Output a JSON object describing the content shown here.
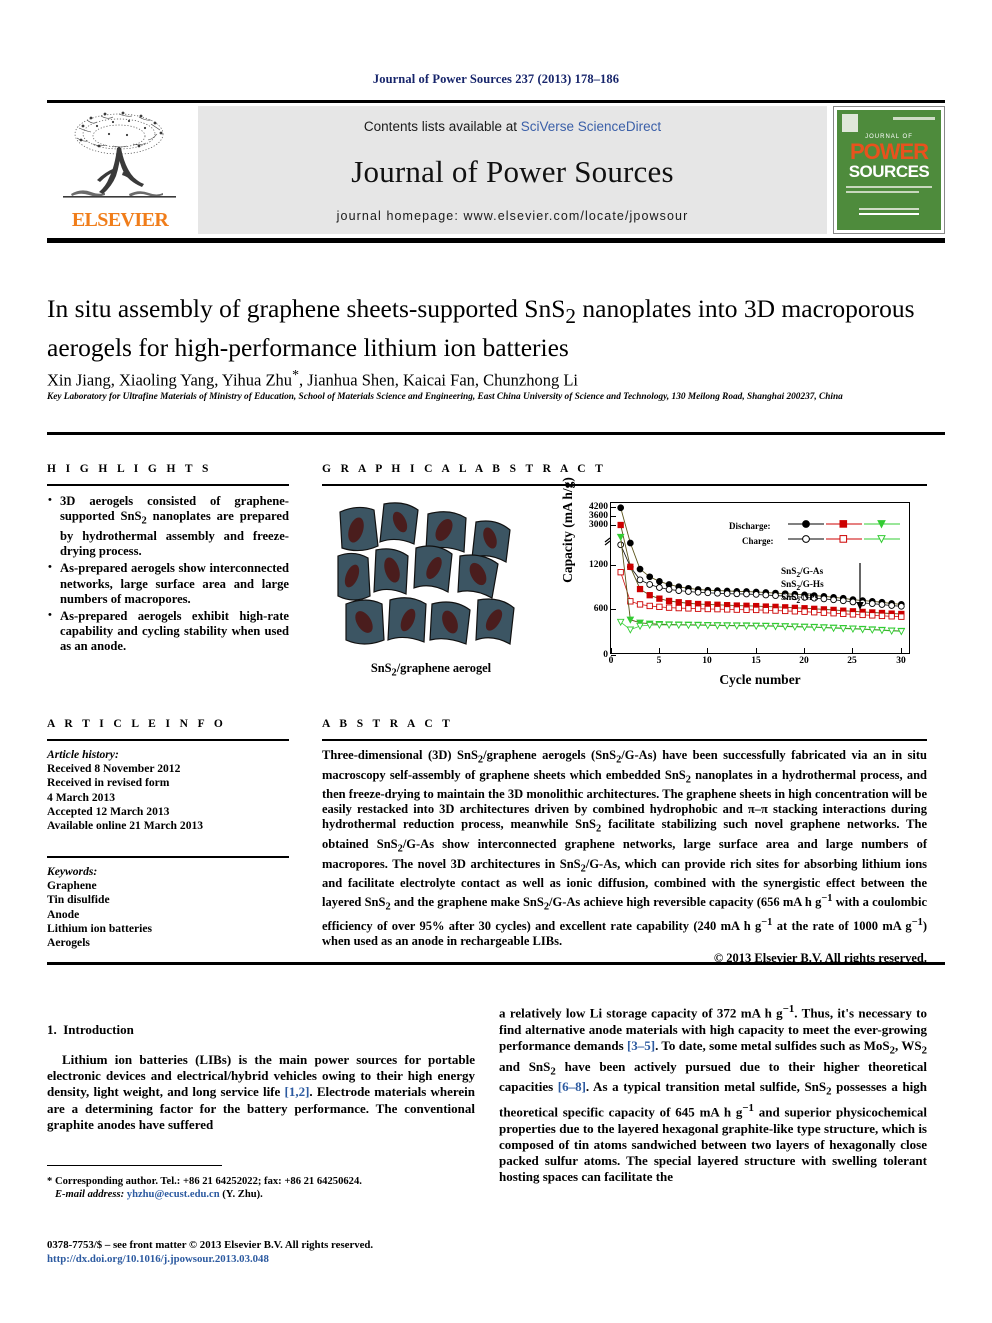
{
  "running_head": "Journal of Power Sources 237 (2013) 178–186",
  "banner": {
    "contents_prefix": "Contents lists available at ",
    "sciencedirect": "SciVerse ScienceDirect",
    "journal_name": "Journal of Power Sources",
    "homepage": "journal homepage: www.elsevier.com/locate/jpowsour",
    "publisher": "ELSEVIER",
    "cover": {
      "line1": "JOURNAL OF",
      "line2": "POWER",
      "line3": "SOURCES"
    }
  },
  "article": {
    "title": "In situ assembly of graphene sheets-supported SnS2 nanoplates into 3D macroporous aerogels for high-performance lithium ion batteries",
    "authors": "Xin Jiang, Xiaoling Yang, Yihua Zhu*, Jianhua Shen, Kaicai Fan, Chunzhong Li",
    "affiliation": "Key Laboratory for Ultrafine Materials of Ministry of Education, School of Materials Science and Engineering, East China University of Science and Technology, 130 Meilong Road, Shanghai 200237, China"
  },
  "highlights": {
    "heading": "H I G H L I G H T S",
    "items": [
      "3D aerogels consisted of graphene-supported SnS2 nanoplates are prepared by hydrothermal assembly and freeze-drying process.",
      "As-prepared aerogels show interconnected networks, large surface area and large numbers of macropores.",
      "As-prepared aerogels exhibit high-rate capability and cycling stability when used as an anode."
    ]
  },
  "graphical_abstract": {
    "heading": "G R A P H I C A L   A B S T R A C T",
    "caption": "SnS2/graphene aerogel"
  },
  "chart_data": {
    "type": "line",
    "title": "",
    "xlabel": "Cycle number",
    "ylabel": "Capacity (mA h/g)",
    "xlim": [
      0,
      31
    ],
    "xticks": [
      0,
      5,
      10,
      15,
      20,
      25,
      30
    ],
    "yticks_lower": [
      0,
      600,
      1200
    ],
    "yticks_upper": [
      3000,
      3600,
      4200
    ],
    "broken_axis": true,
    "grid": false,
    "legend_position": "upper-right",
    "legend_groups": [
      {
        "label": "Discharge:",
        "marker_fill": "filled"
      },
      {
        "label": "Charge:",
        "marker_fill": "open"
      }
    ],
    "series_labels": [
      "SnS2/G-As",
      "SnS2/G-Hs",
      "SnS2 NPs"
    ],
    "series_label_arrow": "down-arrow",
    "colors": {
      "sns2_g_as": "#000000",
      "sns2_g_hs": "#cc0000",
      "sns2_nps": "#33cc33"
    },
    "x": [
      1,
      2,
      3,
      4,
      5,
      6,
      7,
      8,
      9,
      10,
      11,
      12,
      13,
      14,
      15,
      16,
      17,
      18,
      19,
      20,
      21,
      22,
      23,
      24,
      25,
      26,
      27,
      28,
      29,
      30
    ],
    "series": [
      {
        "name": "SnS2/G-As discharge",
        "color": "#000000",
        "marker": "filled-circle",
        "values": [
          4150,
          1800,
          1120,
          1020,
          960,
          920,
          890,
          870,
          855,
          845,
          840,
          835,
          830,
          828,
          822,
          815,
          808,
          800,
          792,
          785,
          775,
          765,
          752,
          740,
          722,
          710,
          700,
          688,
          672,
          660
        ]
      },
      {
        "name": "SnS2/G-As charge",
        "color": "#000000",
        "marker": "open-circle",
        "values": [
          1680,
          1150,
          980,
          920,
          880,
          855,
          840,
          828,
          818,
          812,
          805,
          800,
          798,
          795,
          790,
          782,
          775,
          768,
          760,
          752,
          742,
          732,
          720,
          708,
          692,
          680,
          670,
          658,
          645,
          635
        ]
      },
      {
        "name": "SnS2/G-Hs discharge",
        "color": "#cc0000",
        "marker": "filled-square",
        "values": [
          3000,
          1150,
          860,
          780,
          735,
          705,
          688,
          675,
          665,
          660,
          655,
          650,
          645,
          642,
          638,
          632,
          628,
          622,
          615,
          610,
          602,
          595,
          588,
          578,
          570,
          562,
          555,
          548,
          540,
          535
        ]
      },
      {
        "name": "SnS2/G-Hs charge",
        "color": "#cc0000",
        "marker": "open-square",
        "values": [
          1080,
          700,
          660,
          640,
          628,
          618,
          612,
          608,
          604,
          600,
          598,
          595,
          592,
          590,
          588,
          584,
          580,
          575,
          570,
          565,
          558,
          552,
          545,
          537,
          530,
          523,
          517,
          510,
          505,
          500
        ]
      },
      {
        "name": "SnS2 NPs discharge",
        "color": "#33cc33",
        "marker": "filled-triangle",
        "values": [
          2200,
          460,
          420,
          408,
          402,
          398,
          396,
          394,
          392,
          390,
          388,
          386,
          385,
          384,
          382,
          380,
          378,
          375,
          372,
          368,
          365,
          360,
          355,
          350,
          344,
          338,
          332,
          326,
          318,
          312
        ]
      },
      {
        "name": "SnS2 NPs charge",
        "color": "#33cc33",
        "marker": "open-triangle",
        "values": [
          430,
          330,
          378,
          390,
          392,
          392,
          390,
          388,
          386,
          385,
          383,
          382,
          380,
          379,
          377,
          375,
          373,
          370,
          367,
          363,
          360,
          355,
          350,
          345,
          340,
          334,
          328,
          322,
          314,
          308
        ]
      }
    ]
  },
  "article_info": {
    "heading": "A R T I C L E   I N F O",
    "history_label": "Article history:",
    "history": [
      "Received 8 November 2012",
      "Received in revised form",
      "4 March 2013",
      "Accepted 12 March 2013",
      "Available online 21 March 2013"
    ],
    "keywords_label": "Keywords:",
    "keywords": [
      "Graphene",
      "Tin disulfide",
      "Anode",
      "Lithium ion batteries",
      "Aerogels"
    ]
  },
  "abstract": {
    "heading": "A B S T R A C T",
    "text": "Three-dimensional (3D) SnS2/graphene aerogels (SnS2/G-As) have been successfully fabricated via an in situ macroscopy self-assembly of graphene sheets which embedded SnS2 nanoplates in a hydrothermal process, and then freeze-drying to maintain the 3D monolithic architectures. The graphene sheets in high concentration will be easily restacked into 3D architectures driven by combined hydrophobic and π–π stacking interactions during hydrothermal reduction process, meanwhile SnS2 facilitate stabilizing such novel graphene networks. The obtained SnS2/G-As show interconnected graphene networks, large surface area and large numbers of macropores. The novel 3D architectures in SnS2/G-As, which can provide rich sites for absorbing lithium ions and facilitate electrolyte contact as well as ionic diffusion, combined with the synergistic effect between the layered SnS2 and the graphene make SnS2/G-As achieve high reversible capacity (656 mA h g−1 with a coulombic efficiency of over 95% after 30 cycles) and excellent rate capability (240 mA h g−1 at the rate of 1000 mA g−1) when used as an anode in rechargeable LIBs.",
    "copyright": "© 2013 Elsevier B.V. All rights reserved."
  },
  "introduction": {
    "section_number": "1.",
    "section_title": "Introduction",
    "paragraph_left": "Lithium ion batteries (LIBs) is the main power sources for portable electronic devices and electrical/hybrid vehicles owing to their high energy density, light weight, and long service life [1,2]. Electrode materials wherein are a determining factor for the battery performance. The conventional graphite anodes have suffered",
    "paragraph_right": "a relatively low Li storage capacity of 372 mA h g−1. Thus, it's necessary to find alternative anode materials with high capacity to meet the ever-growing performance demands [3–5]. To date, some metal sulfides such as MoS2, WS2 and SnS2 have been actively pursued due to their higher theoretical capacities [6–8]. As a typical transition metal sulfide, SnS2 possesses a high theoretical specific capacity of 645 mA h g−1 and superior physicochemical properties due to the layered hexagonal graphite-like type structure, which is composed of tin atoms sandwiched between two layers of hexagonally close packed sulfur atoms. The special layered structure with swelling tolerant hosting spaces can facilitate the"
  },
  "footnotes": {
    "corresponding": "* Corresponding author. Tel.: +86 21 64252022; fax: +86 21 64250624.",
    "email_label": "E-mail address:",
    "email": "yhzhu@ecust.edu.cn",
    "email_suffix": "(Y. Zhu).",
    "issn_line": "0378-7753/$ – see front matter © 2013 Elsevier B.V. All rights reserved.",
    "doi": "http://dx.doi.org/10.1016/j.jpowsour.2013.03.048"
  }
}
